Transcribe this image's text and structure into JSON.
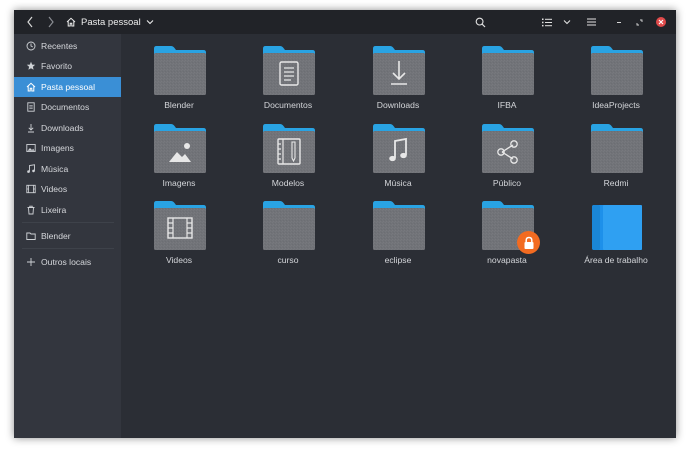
{
  "header": {
    "path_label": "Pasta pessoal",
    "icons": [
      "back-icon",
      "forward-icon",
      "home-icon",
      "chevron-down-icon",
      "search-icon",
      "list-view-icon",
      "sort-chevron-icon",
      "menu-icon",
      "minimize-icon",
      "maximize-icon",
      "close-icon"
    ]
  },
  "sidebar": {
    "items": [
      {
        "label": "Recentes",
        "icon": "clock-icon"
      },
      {
        "label": "Favorito",
        "icon": "star-icon"
      },
      {
        "label": "Pasta pessoal",
        "icon": "home-icon",
        "active": true
      },
      {
        "label": "Documentos",
        "icon": "document-icon"
      },
      {
        "label": "Downloads",
        "icon": "download-icon"
      },
      {
        "label": "Imagens",
        "icon": "image-icon"
      },
      {
        "label": "Música",
        "icon": "music-icon"
      },
      {
        "label": "Videos",
        "icon": "film-icon"
      },
      {
        "label": "Lixeira",
        "icon": "trash-icon"
      },
      {
        "label": "Blender",
        "icon": "folder-icon"
      },
      {
        "label": "Outros locais",
        "icon": "plus-icon"
      }
    ]
  },
  "colors": {
    "accent": "#3a8fd6",
    "folder_tab": "#29a3e3",
    "folder_body": "#717378",
    "lock_badge": "#f26b21",
    "close_button": "#e04a4a"
  },
  "folders": [
    {
      "label": "Blender",
      "icon": "folder-icon"
    },
    {
      "label": "Documentos",
      "icon": "document-folder-icon"
    },
    {
      "label": "Downloads",
      "icon": "download-folder-icon"
    },
    {
      "label": "IFBA",
      "icon": "folder-icon"
    },
    {
      "label": "IdeaProjects",
      "icon": "folder-icon"
    },
    {
      "label": "Imagens",
      "icon": "image-folder-icon"
    },
    {
      "label": "Modelos",
      "icon": "templates-folder-icon"
    },
    {
      "label": "Música",
      "icon": "music-folder-icon"
    },
    {
      "label": "Público",
      "icon": "share-folder-icon"
    },
    {
      "label": "Redmi",
      "icon": "folder-icon"
    },
    {
      "label": "Videos",
      "icon": "video-folder-icon"
    },
    {
      "label": "curso",
      "icon": "folder-icon"
    },
    {
      "label": "eclipse",
      "icon": "folder-icon"
    },
    {
      "label": "novapasta",
      "icon": "locked-folder-icon",
      "locked": true
    },
    {
      "label": "Área de trabalho",
      "icon": "desktop-folder-icon"
    }
  ]
}
